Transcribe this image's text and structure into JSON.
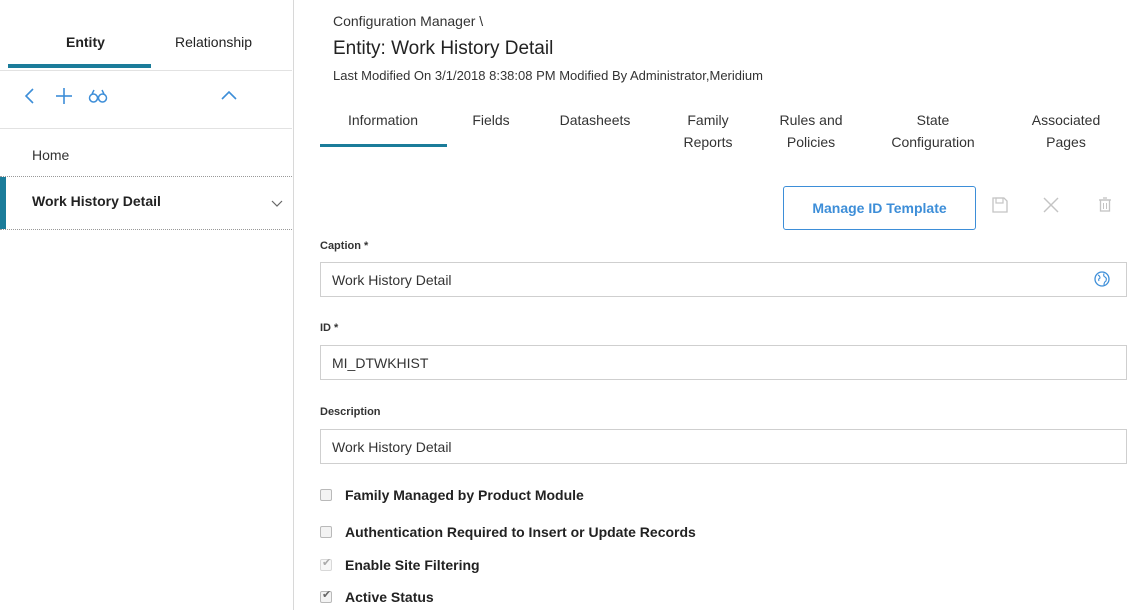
{
  "left_panel": {
    "tabs": [
      {
        "label": "Entity",
        "active": true
      },
      {
        "label": "Relationship",
        "active": false
      }
    ],
    "toolbar_icons": [
      "back-icon",
      "add-icon",
      "search-binoculars-icon",
      "collapse-icon"
    ],
    "nav_items": [
      {
        "label": "Home"
      },
      {
        "label": "Work History Detail",
        "selected": true
      }
    ]
  },
  "header": {
    "breadcrumb": "Configuration Manager \\",
    "title": "Entity: Work History Detail",
    "modified": "Last Modified On 3/1/2018 8:38:08 PM Modified By Administrator,Meridium"
  },
  "content_tabs": [
    {
      "line1": "Information",
      "line2": "",
      "active": true
    },
    {
      "line1": "Fields",
      "line2": ""
    },
    {
      "line1": "Datasheets",
      "line2": ""
    },
    {
      "line1": "Family",
      "line2": "Reports"
    },
    {
      "line1": "Rules and",
      "line2": "Policies"
    },
    {
      "line1": "State",
      "line2": "Configuration"
    },
    {
      "line1": "Associated",
      "line2": "Pages"
    }
  ],
  "actions": {
    "manage_id_template": "Manage ID Template",
    "icons": [
      "save-icon",
      "close-icon",
      "delete-icon"
    ]
  },
  "form": {
    "caption": {
      "label": "Caption *",
      "value": "Work History Detail"
    },
    "id": {
      "label": "ID *",
      "value": "MI_DTWKHIST"
    },
    "description": {
      "label": "Description",
      "value": "Work History Detail"
    }
  },
  "checkboxes": [
    {
      "label": "Family Managed by Product Module",
      "checked": false
    },
    {
      "label": "Authentication Required to Insert or Update Records",
      "checked": false
    },
    {
      "label": "Enable Site Filtering",
      "checked": true
    },
    {
      "label": "Active Status",
      "checked": true
    }
  ],
  "colors": {
    "accent": "#1b7c9a",
    "button": "#3d8ed8"
  }
}
